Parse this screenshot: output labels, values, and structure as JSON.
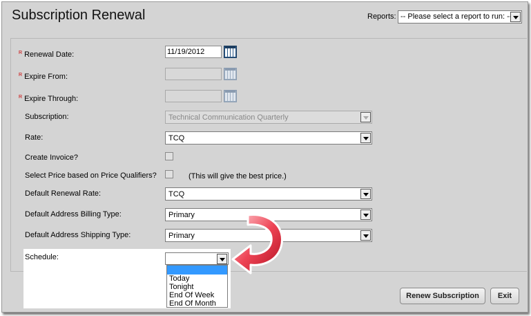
{
  "page": {
    "title": "Subscription Renewal"
  },
  "reports": {
    "label": "Reports:",
    "selected": "-- Please select a report to run: --"
  },
  "form": {
    "renewal_date": {
      "label": "Renewal Date:",
      "required_mark": "R",
      "value": "11/19/2012"
    },
    "expire_from": {
      "label": "Expire From:",
      "required_mark": "R",
      "value": ""
    },
    "expire_through": {
      "label": "Expire Through:",
      "required_mark": "R",
      "value": ""
    },
    "subscription": {
      "label": "Subscription:",
      "value": "Technical Communication Quarterly"
    },
    "rate": {
      "label": "Rate:",
      "value": "TCQ"
    },
    "create_invoice": {
      "label": "Create Invoice?",
      "checked": false
    },
    "price_qualifiers": {
      "label": "Select Price based on Price Qualifiers?",
      "checked": false,
      "note": "(This will give the best price.)"
    },
    "default_renewal_rate": {
      "label": "Default Renewal Rate:",
      "value": "TCQ"
    },
    "billing_type": {
      "label": "Default Address Billing Type:",
      "value": "Primary"
    },
    "shipping_type": {
      "label": "Default Address Shipping Type:",
      "value": "Primary"
    },
    "schedule": {
      "label": "Schedule:",
      "value": "",
      "options": [
        "",
        "Today",
        "Tonight",
        "End Of Week",
        "End Of Month"
      ]
    }
  },
  "buttons": {
    "renew": "Renew Subscription",
    "exit": "Exit"
  },
  "colors": {
    "background": "#d4d4d4",
    "required": "#cc0000",
    "arrow": "#e03040",
    "selected_option": "#3399ff"
  }
}
